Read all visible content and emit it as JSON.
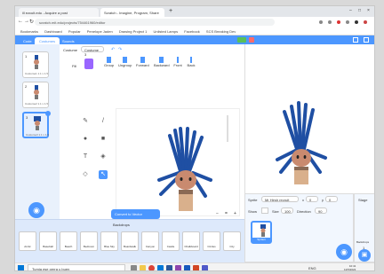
{
  "browser": {
    "tabs": [
      {
        "label": "ill ezcuit.edu - Acquire a post"
      },
      {
        "label": "Scratch - Imagine, Program, Share"
      }
    ],
    "new_tab_symbol": "+",
    "window_controls": [
      "–",
      "□",
      "×"
    ],
    "url": "scratch.mit.edu/projects/754461960/editor",
    "nav_icons": [
      "arrow-left-icon",
      "arrow-right-icon",
      "reload-icon"
    ],
    "bookmarks": [
      "Bookmarks",
      "Dashboard",
      "Popular",
      "Penelope Jaden",
      "Drawing Project 1",
      "Unlisted Lamps",
      "Facebook",
      "SCS Breaking Dev"
    ]
  },
  "scratch": {
    "menu_tabs": [
      {
        "label": "Code"
      },
      {
        "label": "Costumes"
      },
      {
        "label": "Sounds"
      }
    ],
    "costumes": [
      {
        "number": "1",
        "label": "Costume1 1.1 x 1.5"
      },
      {
        "number": "2",
        "label": "Costume2 1.1 x 1.5"
      },
      {
        "number": "3",
        "label": "Costume3 1.1 x 1.5"
      }
    ],
    "paint_editor": {
      "costume_label": "Costume",
      "costume_name": "Costume 3",
      "fill_label": "Fill",
      "outline_label": "Outline",
      "toolbar_buttons": [
        "Group",
        "Ungroup",
        "Forward",
        "Backward",
        "Front",
        "Back"
      ],
      "convert_button": "Convert to Vector",
      "zoom_controls": [
        "−",
        "=",
        "+"
      ]
    },
    "backdrop_library": {
      "title": "Backdrops",
      "items": [
        "Arctic",
        "Baseball",
        "Beach",
        "Bedroom",
        "Blue Sky",
        "Boardwalk",
        "Canyon",
        "Castle",
        "Chalkboard",
        "Circles",
        "City"
      ]
    },
    "sprite_info": {
      "sprite_label": "Sprite",
      "sprite_name": "Mr Hirsh recruit",
      "x_label": "x",
      "x_value": "0",
      "y_label": "y",
      "y_value": "0",
      "show_label": "Show",
      "size_label": "Size",
      "size_value": "100",
      "direction_label": "Direction",
      "direction_value": "90",
      "sprite_thumb_label": "Sprite1"
    },
    "stage_pane": {
      "title": "Stage",
      "backdrops_label": "Backdrops",
      "backdrops_count": "1"
    }
  },
  "taskbar": {
    "search_placeholder": "Tumia ese perra u buen",
    "time": "10:41",
    "date": "12/5/2022",
    "tray_text": "ENG",
    "apps": [
      "file-explorer",
      "chrome",
      "mail",
      "store",
      "photos",
      "word",
      "powerpoint",
      "teams"
    ]
  },
  "colors": {
    "accent": "#4c97ff",
    "hair": "#1f4fa3",
    "skin": "#c98a6f",
    "fill_swatch": "#9966ff"
  }
}
